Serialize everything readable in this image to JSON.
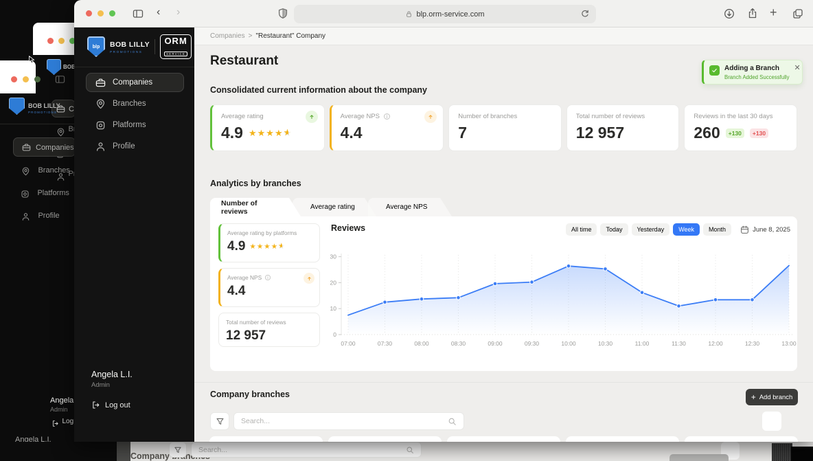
{
  "browser": {
    "url": "blp.orm-service.com",
    "back": "‹",
    "forward": "›",
    "newtab": "+"
  },
  "brand": {
    "name": "BOB LILLY",
    "tagline": "PROMOTIONS",
    "product": "ORM",
    "product_sub": "SERVICE"
  },
  "breadcrumb": {
    "root": "Companies",
    "sep": ">",
    "current": "\"Restaurant\" Company"
  },
  "sidebar": {
    "items": [
      {
        "label": "Companies"
      },
      {
        "label": "Branches"
      },
      {
        "label": "Platforms"
      },
      {
        "label": "Profile"
      }
    ],
    "user": {
      "name": "Angela L.I.",
      "role": "Admin",
      "logout": "Log out"
    }
  },
  "page": {
    "title": "Restaurant",
    "summary_heading": "Consolidated current information about the company",
    "analytics_heading": "Analytics by branches",
    "branches_heading": "Company branches"
  },
  "toast": {
    "title": "Adding a Branch",
    "message": "Branch Added Successfully",
    "close": "✕"
  },
  "summary_cards": [
    {
      "label": "Average rating",
      "value": "4.9",
      "stars": 4.5,
      "accent": "green",
      "trend": "up"
    },
    {
      "label": "Average NPS",
      "value": "4.4",
      "accent": "yellow",
      "trend": "up"
    },
    {
      "label": "Number of branches",
      "value": "7"
    },
    {
      "label": "Total number of reviews",
      "value": "12 957"
    },
    {
      "label": "Reviews in the last 30 days",
      "value": "260",
      "badge_up": "+130",
      "badge_down": "+130"
    }
  ],
  "analytics": {
    "tabs": [
      {
        "label": "Number of reviews",
        "active": true
      },
      {
        "label": "Average rating",
        "active": false
      },
      {
        "label": "Average NPS",
        "active": false
      }
    ],
    "side_cards": [
      {
        "label": "Average rating by platforms",
        "value": "4.9",
        "stars": 4.5,
        "accent": "green"
      },
      {
        "label": "Average NPS",
        "value": "4.4",
        "accent": "yellow",
        "trend": "up"
      },
      {
        "label": "Total number of reviews",
        "value": "12 957"
      }
    ],
    "filters": [
      "All time",
      "Today",
      "Yesterday",
      "Week",
      "Month"
    ],
    "active_filter": "Week",
    "date": "June 8, 2025"
  },
  "chart_data": {
    "type": "line",
    "title": "Reviews",
    "x": [
      "07:00",
      "07:30",
      "08:00",
      "08:30",
      "09:00",
      "09:30",
      "10:00",
      "10:30",
      "11:00",
      "11:30",
      "12:00",
      "12:30",
      "13:00"
    ],
    "series": [
      {
        "name": "Reviews",
        "values": [
          7.5,
          12.5,
          13.7,
          14.2,
          19.6,
          20.2,
          26.4,
          25.3,
          16.2,
          11,
          13.4,
          13.4,
          26.6
        ]
      }
    ],
    "xlabel": "",
    "ylabel": "",
    "ylim": [
      0,
      30
    ],
    "yticks": [
      0,
      10,
      20,
      30
    ],
    "grid": "vertical-dotted",
    "legend": "none",
    "line_color": "#3b7df6",
    "area_fill": "blue-gradient"
  },
  "branches": {
    "add_plus": "+",
    "add_label": "Add branch",
    "search_placeholder": "Search..."
  },
  "bg": {
    "company_branches": "Company branches",
    "search_placeholder": "Search..."
  }
}
